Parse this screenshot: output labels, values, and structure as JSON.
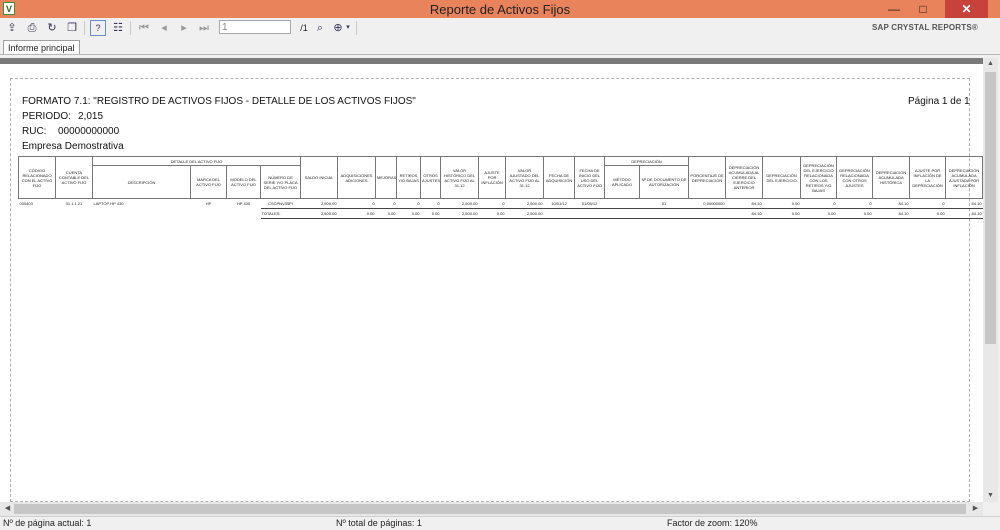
{
  "window": {
    "title": "Reporte de Activos Fijos",
    "app_icon": "V",
    "controls": [
      "—",
      "□",
      "✕"
    ]
  },
  "toolbar": {
    "page_value": "1",
    "page_total": "/1",
    "brand": "SAP CRYSTAL REPORTS®"
  },
  "tabs": [
    {
      "label": "Informe principal"
    }
  ],
  "report": {
    "format_title": "FORMATO 7.1: \"REGISTRO DE ACTIVOS FIJOS - DETALLE DE LOS ACTIVOS FIJOS\"",
    "periodo_label": "PERIODO:",
    "periodo_value": "2,015",
    "ruc_label": "RUC:",
    "ruc_value": "00000000000",
    "company": "Empresa Demostrativa",
    "page_info": "Página 1 de 1",
    "group_headers": {
      "detalle": "DETALLE DEL ACTIVO FIJO",
      "depreciacion": "DEPRECIACIÓN"
    },
    "columns": [
      "CÓDIGO RELACIONADO CON EL ACTIVO FIJO",
      "CUENTA CONTABLE DEL ACTIVO FIJO",
      "DESCRIPCIÓN",
      "MARCA DEL ACTIVO FIJO",
      "MODELO DEL ACTIVO FIJO",
      "NÚMERO DE SERIE Y/O PLACA DEL ACTIVO FIJO",
      "SALDO INICIAL",
      "ADQUISICIONES ADICIONES",
      "MEJORAS",
      "RETIROS Y/O BAJAS",
      "OTROS AJUSTES",
      "VALOR HISTÓRICO DEL ACTIVO FIJO AL 31.12",
      "AJUSTE POR INFLACIÓN",
      "VALOR AJUSTADO DEL ACTIVO FIJO AL 31.12",
      "FECHA DE ADQUISICIÓN",
      "FECHA DE INICIO DEL USO DEL ACTIVO FIJO",
      "MÉTODO APLICADO",
      "Nº DE DOCUMENTO DE AUTORIZACIÓN",
      "PORCENTAJE DE DEPRECIACIÓN",
      "DEPRECIACIÓN ACUMULADA AL CIERRE DEL EJERCICIO ANTERIOR",
      "DEPRECIACIÓN DEL EJERCICIO",
      "DEPRECIACIÓN DEL EJERCICIO RELACIONADA CON LOS RETIROS Y/O BAJAS",
      "DEPRECIACIÓN RELACIONADA CON OTROS AJUSTES",
      "DEPRECIACIÓN ACUMULADA HISTÓRICA",
      "AJUSTE POR INFLACIÓN DE LA DEPRECIACIÓN",
      "DEPRECIACIÓN ACUMULADA AJUSTADA POR INFLACIÓN"
    ],
    "rows": [
      [
        "000403",
        "31.1.1.21",
        "LAPTOP HP 430",
        "HP",
        "HP 430",
        "CSCPNV35PI",
        "2,500.00",
        "0",
        "0",
        "0",
        "0",
        "2,500.00",
        "0",
        "2,500.00",
        "10/01/12",
        "01/05/12",
        "",
        "01",
        "0.00000000",
        "84.10",
        "0.00",
        "0",
        "0",
        "84.10",
        "0",
        "84.10"
      ]
    ],
    "totals_label": "TOTALES:",
    "totals": [
      "2,500.00",
      "0.00",
      "0.00",
      "0.00",
      "0.00",
      "2,500.00",
      "0.00",
      "2,500.00",
      "",
      "",
      "",
      "",
      "",
      "84.10",
      "0.00",
      "0.00",
      "0.00",
      "84.10",
      "0.00",
      "84.10"
    ]
  },
  "status": {
    "current_page": "Nº de página actual: 1",
    "total_pages": "Nº total de páginas: 1",
    "zoom": "Factor de zoom: 120%"
  }
}
